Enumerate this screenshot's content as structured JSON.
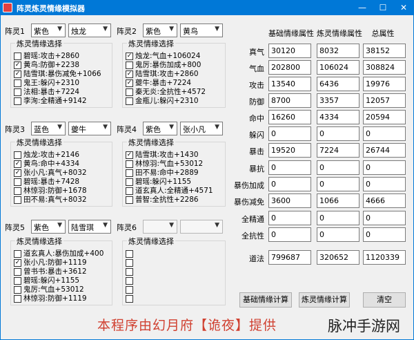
{
  "window": {
    "title": "阵灵炼灵情缘模拟器",
    "minimize": "—",
    "maximize": "☐",
    "close": "✕"
  },
  "slots": [
    {
      "label": "阵灵1",
      "quality": "紫色",
      "spirit": "烛龙",
      "group_title": "炼灵情缘选择",
      "options": [
        {
          "text": "碧瑶:攻击+2860",
          "checked": false
        },
        {
          "text": "黄鸟:防御+2238",
          "checked": true
        },
        {
          "text": "陆雪琪:暴伤减免+1066",
          "checked": true
        },
        {
          "text": "鬼王:躲闪+2310",
          "checked": false
        },
        {
          "text": "法相:暴击+7224",
          "checked": false
        },
        {
          "text": "李洵:全精通+9142",
          "checked": false
        }
      ]
    },
    {
      "label": "阵灵2",
      "quality": "紫色",
      "spirit": "黄鸟",
      "group_title": "炼灵情缘选择",
      "options": [
        {
          "text": "烛龙:气血+106024",
          "checked": true
        },
        {
          "text": "鬼厉:暴伤加成+800",
          "checked": false
        },
        {
          "text": "陆雪琪:攻击+2860",
          "checked": true
        },
        {
          "text": "夔牛:暴击+7224",
          "checked": true
        },
        {
          "text": "秦无炎:全抗性+4572",
          "checked": false
        },
        {
          "text": "金瓶儿:躲闪+2310",
          "checked": false
        }
      ]
    },
    {
      "label": "阵灵3",
      "quality": "蓝色",
      "spirit": "夔牛",
      "group_title": "炼灵情缘选择",
      "options": [
        {
          "text": "烛龙:攻击+2146",
          "checked": false
        },
        {
          "text": "黄鸟:命中+4334",
          "checked": true
        },
        {
          "text": "张小凡:真气+8032",
          "checked": true
        },
        {
          "text": "碧瑶:暴击+7428",
          "checked": false
        },
        {
          "text": "林惊羽:防御+1678",
          "checked": false
        },
        {
          "text": "田不易:真气+8032",
          "checked": false
        }
      ]
    },
    {
      "label": "阵灵4",
      "quality": "紫色",
      "spirit": "张小凡",
      "group_title": "炼灵情缘选择",
      "options": [
        {
          "text": "陆雪琪:攻击+1430",
          "checked": true
        },
        {
          "text": "林惊羽:气血+53012",
          "checked": false
        },
        {
          "text": "田不易:命中+2889",
          "checked": false
        },
        {
          "text": "碧瑶:躲闪+1155",
          "checked": false
        },
        {
          "text": "道玄真人:全精通+4571",
          "checked": false
        },
        {
          "text": "普智:全抗性+2286",
          "checked": false
        }
      ]
    },
    {
      "label": "阵灵5",
      "quality": "紫色",
      "spirit": "陆雪琪",
      "group_title": "炼灵情缘选择",
      "options": [
        {
          "text": "道玄真人:暴伤加成+400",
          "checked": false
        },
        {
          "text": "张小凡:防御+1119",
          "checked": true
        },
        {
          "text": "曾书书:暴击+3612",
          "checked": false
        },
        {
          "text": "碧瑶:躲闪+1155",
          "checked": false
        },
        {
          "text": "鬼厉:气血+53012",
          "checked": false
        },
        {
          "text": "林惊羽:防御+1119",
          "checked": false
        }
      ]
    },
    {
      "label": "阵灵6",
      "quality": "",
      "spirit": "",
      "group_title": "炼灵情缘选择",
      "options": [
        {
          "text": "",
          "checked": false
        },
        {
          "text": "",
          "checked": false
        },
        {
          "text": "",
          "checked": false
        },
        {
          "text": "",
          "checked": false
        },
        {
          "text": "",
          "checked": false
        },
        {
          "text": "",
          "checked": false
        }
      ]
    }
  ],
  "stats": {
    "headers": [
      "基础情缘属性",
      "炼灵情缘属性",
      "总属性"
    ],
    "rows": [
      {
        "label": "真气",
        "values": [
          "30120",
          "8032",
          "38152"
        ]
      },
      {
        "label": "气血",
        "values": [
          "202800",
          "106024",
          "308824"
        ]
      },
      {
        "label": "攻击",
        "values": [
          "13540",
          "6436",
          "19976"
        ]
      },
      {
        "label": "防御",
        "values": [
          "8700",
          "3357",
          "12057"
        ]
      },
      {
        "label": "命中",
        "values": [
          "16260",
          "4334",
          "20594"
        ]
      },
      {
        "label": "躲闪",
        "values": [
          "0",
          "0",
          "0"
        ]
      },
      {
        "label": "暴击",
        "values": [
          "19520",
          "7224",
          "26744"
        ]
      },
      {
        "label": "暴抗",
        "values": [
          "0",
          "0",
          "0"
        ]
      },
      {
        "label": "暴伤加成",
        "values": [
          "0",
          "0",
          "0"
        ]
      },
      {
        "label": "暴伤减免",
        "values": [
          "3600",
          "1066",
          "4666"
        ]
      },
      {
        "label": "全精通",
        "values": [
          "0",
          "0",
          "0"
        ]
      },
      {
        "label": "全抗性",
        "values": [
          "0",
          "0",
          "0"
        ]
      },
      {
        "label": "道法",
        "values": [
          "799687",
          "320652",
          "1120339"
        ]
      }
    ]
  },
  "buttons": {
    "base_calc": "基础情缘计算",
    "refine_calc": "炼灵情缘计算",
    "clear": "清空"
  },
  "footer": {
    "credit": "本程序由幻月府【诡夜】提供",
    "watermark": "脉冲手游网"
  },
  "colors": {
    "titlebar": "#0078d7",
    "credit": "#d04030",
    "window_bg": "#f0f0f0"
  }
}
